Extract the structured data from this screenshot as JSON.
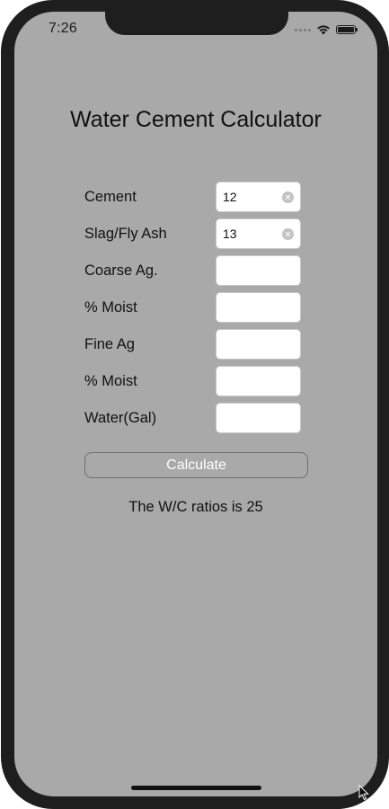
{
  "status_bar": {
    "time": "7:26",
    "icons": [
      "signal-dots-icon",
      "wifi-icon",
      "battery-icon"
    ]
  },
  "app": {
    "title": "Water Cement Calculator"
  },
  "form": {
    "fields": [
      {
        "label": "Cement",
        "value": "12",
        "has_clear": true
      },
      {
        "label": "Slag/Fly Ash",
        "value": "13",
        "has_clear": true
      },
      {
        "label": "Coarse Ag.",
        "value": "",
        "has_clear": false
      },
      {
        "label": "% Moist",
        "value": "",
        "has_clear": false
      },
      {
        "label": "Fine Ag",
        "value": "",
        "has_clear": false
      },
      {
        "label": "% Moist",
        "value": "",
        "has_clear": false
      },
      {
        "label": "Water(Gal)",
        "value": "",
        "has_clear": false
      }
    ]
  },
  "calculate_button": {
    "label": "Calculate"
  },
  "result": {
    "text": "The W/C ratios is 25"
  },
  "colors": {
    "screen_background": "#a9a9a9",
    "frame": "#1e1e1e",
    "input_background": "#ffffff",
    "text": "#111111",
    "button_text": "#ffffff"
  }
}
